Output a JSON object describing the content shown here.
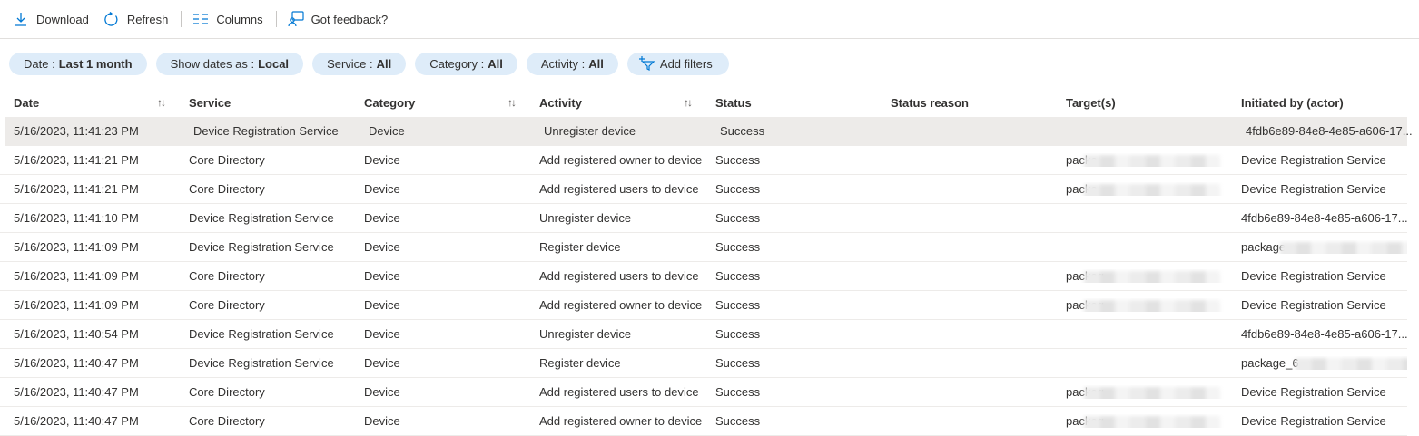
{
  "toolbar": {
    "download": "Download",
    "refresh": "Refresh",
    "columns": "Columns",
    "feedback": "Got feedback?"
  },
  "filters": [
    {
      "label": "Date :",
      "value": "Last 1 month"
    },
    {
      "label": "Show dates as :",
      "value": "Local"
    },
    {
      "label": "Service :",
      "value": "All"
    },
    {
      "label": "Category :",
      "value": "All"
    },
    {
      "label": "Activity :",
      "value": "All"
    }
  ],
  "add_filters": "Add filters",
  "columns": [
    "Date",
    "Service",
    "Category",
    "Activity",
    "Status",
    "Status reason",
    "Target(s)",
    "Initiated by (actor)"
  ],
  "rows": [
    {
      "date": "5/16/2023, 11:41:23 PM",
      "service": "Device Registration Service",
      "category": "Device",
      "activity": "Unregister device",
      "status": "Success",
      "reason": "",
      "target": "",
      "actor": "4fdb6e89-84e8-4e85-a606-17..."
    },
    {
      "date": "5/16/2023, 11:41:21 PM",
      "service": "Core Directory",
      "category": "Device",
      "activity": "Add registered owner to device",
      "status": "Success",
      "reason": "",
      "target": "packa",
      "actor": "Device Registration Service"
    },
    {
      "date": "5/16/2023, 11:41:21 PM",
      "service": "Core Directory",
      "category": "Device",
      "activity": "Add registered users to device",
      "status": "Success",
      "reason": "",
      "target": "packa",
      "actor": "Device Registration Service"
    },
    {
      "date": "5/16/2023, 11:41:10 PM",
      "service": "Device Registration Service",
      "category": "Device",
      "activity": "Unregister device",
      "status": "Success",
      "reason": "",
      "target": "",
      "actor": "4fdb6e89-84e8-4e85-a606-17..."
    },
    {
      "date": "5/16/2023, 11:41:09 PM",
      "service": "Device Registration Service",
      "category": "Device",
      "activity": "Register device",
      "status": "Success",
      "reason": "",
      "target": "",
      "actor": "package"
    },
    {
      "date": "5/16/2023, 11:41:09 PM",
      "service": "Core Directory",
      "category": "Device",
      "activity": "Add registered users to device",
      "status": "Success",
      "reason": "",
      "target": "packag",
      "actor": "Device Registration Service"
    },
    {
      "date": "5/16/2023, 11:41:09 PM",
      "service": "Core Directory",
      "category": "Device",
      "activity": "Add registered owner to device",
      "status": "Success",
      "reason": "",
      "target": "packag",
      "actor": "Device Registration Service"
    },
    {
      "date": "5/16/2023, 11:40:54 PM",
      "service": "Device Registration Service",
      "category": "Device",
      "activity": "Unregister device",
      "status": "Success",
      "reason": "",
      "target": "",
      "actor": "4fdb6e89-84e8-4e85-a606-17..."
    },
    {
      "date": "5/16/2023, 11:40:47 PM",
      "service": "Device Registration Service",
      "category": "Device",
      "activity": "Register device",
      "status": "Success",
      "reason": "",
      "target": "",
      "actor": "package_6"
    },
    {
      "date": "5/16/2023, 11:40:47 PM",
      "service": "Core Directory",
      "category": "Device",
      "activity": "Add registered users to device",
      "status": "Success",
      "reason": "",
      "target": "packag",
      "actor": "Device Registration Service"
    },
    {
      "date": "5/16/2023, 11:40:47 PM",
      "service": "Core Directory",
      "category": "Device",
      "activity": "Add registered owner to device",
      "status": "Success",
      "reason": "",
      "target": "packag",
      "actor": "Device Registration Service"
    }
  ],
  "colors": {
    "accent": "#0078d4",
    "pill_bg": "#deecf9",
    "selected_row": "#edebe9"
  }
}
